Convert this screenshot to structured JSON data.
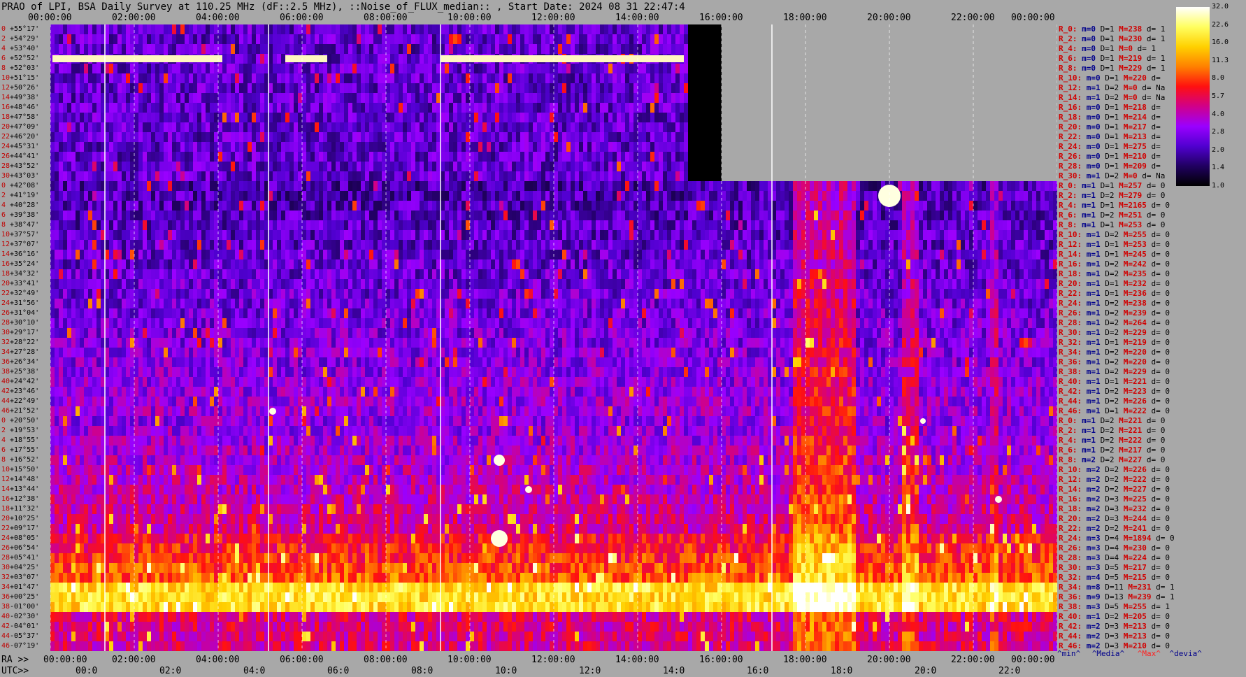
{
  "title": "PRAO of LPI, BSA Daily Survey at 110.25 MHz (dF::2.5 MHz), ::Noise_of_FLUX_median:: , Start Date: 2024 08 31 22:47:4",
  "top_times": [
    "00:00:00",
    "02:00:00",
    "04:00:00",
    "06:00:00",
    "08:00:00",
    "10:00:00",
    "12:00:00",
    "14:00:00",
    "16:00:00",
    "18:00:00",
    "20:00:00",
    "22:00:00",
    "00:00:00"
  ],
  "ra_label": "RA >>",
  "ra_times": [
    "00:00:00",
    "02:00:00",
    "04:00:00",
    "06:00:00",
    "08:00:00",
    "10:00:00",
    "12:00:00",
    "14:00:00",
    "16:00:00",
    "18:00:00",
    "20:00:00",
    "22:00:00",
    "00:00:00"
  ],
  "utc_label": "UTC>>",
  "utc_times": [
    "00:0",
    "02:0",
    "04:0",
    "06:0",
    "08:0",
    "10:0",
    "12:0",
    "14:0",
    "16:0",
    "18:0",
    "20:0",
    "22:0"
  ],
  "colorbar": {
    "ticks": [
      "32.0",
      "22.6",
      "16.0",
      "11.3",
      "8.0",
      "5.7",
      "4.0",
      "2.8",
      "2.0",
      "1.4",
      "1.0"
    ],
    "stops": [
      "#ffffff",
      "#ffff60",
      "#ffd000",
      "#ff8000",
      "#ff1010",
      "#d0008a",
      "#9a00ff",
      "#5000d0",
      "#200060",
      "#000000"
    ]
  },
  "legend_bottom": {
    "min": "^min^",
    "median": "^Media^",
    "max": "^Max^",
    "dev": "^devia^"
  },
  "chart_data": {
    "type": "heatmap",
    "title": "PRAO of LPI, BSA Daily Survey at 110.25 MHz (dF::2.5 MHz), ::Noise_of_FLUX_median:: , Start Date: 2024 08 31 22:47:4",
    "xlabel": "RA / UTC",
    "ylabel": "",
    "colorscale_range": [
      1.0,
      32.0
    ],
    "declinations": [
      "+55°17'",
      "+54°29'",
      "+53°40'",
      "+52°52'",
      "+52°03'",
      "+51°15'",
      "+50°26'",
      "+49°38'",
      "+48°46'",
      "+47°58'",
      "+47°09'",
      "+46°20'",
      "+45°31'",
      "+44°41'",
      "+43°52'",
      "+43°03'",
      "+42°08'",
      "+41°19'",
      "+40°28'",
      "+39°38'",
      "+38°47'",
      "+37°57'",
      "+37°07'",
      "+36°16'",
      "+35°24'",
      "+34°32'",
      "+33°41'",
      "+32°49'",
      "+31°56'",
      "+31°04'",
      "+30°10'",
      "+29°17'",
      "+28°22'",
      "+27°28'",
      "+26°34'",
      "+25°38'",
      "+24°42'",
      "+23°46'",
      "+22°49'",
      "+21°52'",
      "+20°50'",
      "+19°53'",
      "+18°55'",
      "+17°55'",
      "+16°52'",
      "+15°50'",
      "+14°48'",
      "+13°44'",
      "+12°38'",
      "+11°32'",
      "+10°25'",
      "+09°17'",
      "+08°05'",
      "+06°54'",
      "+05°41'",
      "+04°25'",
      "+03°07'",
      "+01°47'",
      "+00°25'",
      "-01°00'",
      "-02°30'",
      "-04°01'",
      "-05°37'",
      "-07°19'"
    ],
    "decl_index": [
      "0",
      "2",
      "4",
      "6",
      "8",
      "10",
      "12",
      "14",
      "16",
      "18",
      "20",
      "22",
      "24",
      "26",
      "28",
      "30",
      "0",
      "2",
      "4",
      "6",
      "8",
      "10",
      "12",
      "14",
      "16",
      "18",
      "20",
      "22",
      "24",
      "26",
      "28",
      "30",
      "32",
      "34",
      "36",
      "38",
      "40",
      "42",
      "44",
      "46",
      "0",
      "2",
      "4",
      "6",
      "8",
      "10",
      "12",
      "14",
      "16",
      "18",
      "20",
      "22",
      "24",
      "26",
      "28",
      "30",
      "32",
      "34",
      "36",
      "38",
      "40",
      "42",
      "44",
      "46"
    ],
    "ra_hours": [
      0,
      2,
      4,
      6,
      8,
      10,
      12,
      14,
      16,
      18,
      20,
      22,
      24
    ]
  },
  "stats": [
    {
      "r": "R_0:",
      "m": "m=0",
      "d": "D=1",
      "mx": "M=238",
      "dv": "d= 1"
    },
    {
      "r": "R_2:",
      "m": "m=0",
      "d": "D=1",
      "mx": "M=230",
      "dv": "d= 1"
    },
    {
      "r": "R_4:",
      "m": "m=0",
      "d": "D=1",
      "mx": "M=0",
      "dv": "d= 1"
    },
    {
      "r": "R_6:",
      "m": "m=0",
      "d": "D=1",
      "mx": "M=219",
      "dv": "d= 1"
    },
    {
      "r": "R_8:",
      "m": "m=0",
      "d": "D=1",
      "mx": "M=229",
      "dv": "d= 1"
    },
    {
      "r": "R_10:",
      "m": "m=0",
      "d": "D=1",
      "mx": "M=220",
      "dv": "d="
    },
    {
      "r": "R_12:",
      "m": "m=1",
      "d": "D=2",
      "mx": "M=0",
      "dv": "d= Na"
    },
    {
      "r": "R_14:",
      "m": "m=1",
      "d": "D=2",
      "mx": "M=0",
      "dv": "d= Na"
    },
    {
      "r": "R_16:",
      "m": "m=0",
      "d": "D=1",
      "mx": "M=218",
      "dv": "d="
    },
    {
      "r": "R_18:",
      "m": "m=0",
      "d": "D=1",
      "mx": "M=214",
      "dv": "d="
    },
    {
      "r": "R_20:",
      "m": "m=0",
      "d": "D=1",
      "mx": "M=217",
      "dv": "d="
    },
    {
      "r": "R_22:",
      "m": "m=0",
      "d": "D=1",
      "mx": "M=213",
      "dv": "d="
    },
    {
      "r": "R_24:",
      "m": "m=0",
      "d": "D=1",
      "mx": "M=275",
      "dv": "d="
    },
    {
      "r": "R_26:",
      "m": "m=0",
      "d": "D=1",
      "mx": "M=210",
      "dv": "d="
    },
    {
      "r": "R_28:",
      "m": "m=0",
      "d": "D=1",
      "mx": "M=209",
      "dv": "d="
    },
    {
      "r": "R_30:",
      "m": "m=1",
      "d": "D=2",
      "mx": "M=0",
      "dv": "d= Na"
    },
    {
      "r": "R_0:",
      "m": "m=1",
      "d": "D=1",
      "mx": "M=257",
      "dv": "d= 0"
    },
    {
      "r": "R_2:",
      "m": "m=1",
      "d": "D=2",
      "mx": "M=279",
      "dv": "d= 0"
    },
    {
      "r": "R_4:",
      "m": "m=1",
      "d": "D=1",
      "mx": "M=2165",
      "dv": "d= 0"
    },
    {
      "r": "R_6:",
      "m": "m=1",
      "d": "D=2",
      "mx": "M=251",
      "dv": "d= 0"
    },
    {
      "r": "R_8:",
      "m": "m=1",
      "d": "D=1",
      "mx": "M=253",
      "dv": "d= 0"
    },
    {
      "r": "R_10:",
      "m": "m=1",
      "d": "D=2",
      "mx": "M=255",
      "dv": "d= 0"
    },
    {
      "r": "R_12:",
      "m": "m=1",
      "d": "D=1",
      "mx": "M=253",
      "dv": "d= 0"
    },
    {
      "r": "R_14:",
      "m": "m=1",
      "d": "D=1",
      "mx": "M=245",
      "dv": "d= 0"
    },
    {
      "r": "R_16:",
      "m": "m=1",
      "d": "D=2",
      "mx": "M=242",
      "dv": "d= 0"
    },
    {
      "r": "R_18:",
      "m": "m=1",
      "d": "D=2",
      "mx": "M=235",
      "dv": "d= 0"
    },
    {
      "r": "R_20:",
      "m": "m=1",
      "d": "D=1",
      "mx": "M=232",
      "dv": "d= 0"
    },
    {
      "r": "R_22:",
      "m": "m=1",
      "d": "D=1",
      "mx": "M=236",
      "dv": "d= 0"
    },
    {
      "r": "R_24:",
      "m": "m=1",
      "d": "D=2",
      "mx": "M=238",
      "dv": "d= 0"
    },
    {
      "r": "R_26:",
      "m": "m=1",
      "d": "D=2",
      "mx": "M=239",
      "dv": "d= 0"
    },
    {
      "r": "R_28:",
      "m": "m=1",
      "d": "D=2",
      "mx": "M=264",
      "dv": "d= 0"
    },
    {
      "r": "R_30:",
      "m": "m=1",
      "d": "D=2",
      "mx": "M=229",
      "dv": "d= 0"
    },
    {
      "r": "R_32:",
      "m": "m=1",
      "d": "D=1",
      "mx": "M=219",
      "dv": "d= 0"
    },
    {
      "r": "R_34:",
      "m": "m=1",
      "d": "D=2",
      "mx": "M=220",
      "dv": "d= 0"
    },
    {
      "r": "R_36:",
      "m": "m=1",
      "d": "D=2",
      "mx": "M=220",
      "dv": "d= 0"
    },
    {
      "r": "R_38:",
      "m": "m=1",
      "d": "D=2",
      "mx": "M=229",
      "dv": "d= 0"
    },
    {
      "r": "R_40:",
      "m": "m=1",
      "d": "D=1",
      "mx": "M=221",
      "dv": "d= 0"
    },
    {
      "r": "R_42:",
      "m": "m=1",
      "d": "D=2",
      "mx": "M=223",
      "dv": "d= 0"
    },
    {
      "r": "R_44:",
      "m": "m=1",
      "d": "D=2",
      "mx": "M=226",
      "dv": "d= 0"
    },
    {
      "r": "R_46:",
      "m": "m=1",
      "d": "D=1",
      "mx": "M=222",
      "dv": "d= 0"
    },
    {
      "r": "R_0:",
      "m": "m=1",
      "d": "D=2",
      "mx": "M=221",
      "dv": "d= 0"
    },
    {
      "r": "R_2:",
      "m": "m=1",
      "d": "D=2",
      "mx": "M=221",
      "dv": "d= 0"
    },
    {
      "r": "R_4:",
      "m": "m=1",
      "d": "D=2",
      "mx": "M=222",
      "dv": "d= 0"
    },
    {
      "r": "R_6:",
      "m": "m=1",
      "d": "D=2",
      "mx": "M=217",
      "dv": "d= 0"
    },
    {
      "r": "R_8:",
      "m": "m=2",
      "d": "D=2",
      "mx": "M=227",
      "dv": "d= 0"
    },
    {
      "r": "R_10:",
      "m": "m=2",
      "d": "D=2",
      "mx": "M=226",
      "dv": "d= 0"
    },
    {
      "r": "R_12:",
      "m": "m=2",
      "d": "D=2",
      "mx": "M=222",
      "dv": "d= 0"
    },
    {
      "r": "R_14:",
      "m": "m=2",
      "d": "D=2",
      "mx": "M=227",
      "dv": "d= 0"
    },
    {
      "r": "R_16:",
      "m": "m=2",
      "d": "D=3",
      "mx": "M=225",
      "dv": "d= 0"
    },
    {
      "r": "R_18:",
      "m": "m=2",
      "d": "D=3",
      "mx": "M=232",
      "dv": "d= 0"
    },
    {
      "r": "R_20:",
      "m": "m=2",
      "d": "D=3",
      "mx": "M=244",
      "dv": "d= 0"
    },
    {
      "r": "R_22:",
      "m": "m=2",
      "d": "D=2",
      "mx": "M=241",
      "dv": "d= 0"
    },
    {
      "r": "R_24:",
      "m": "m=3",
      "d": "D=4",
      "mx": "M=1894",
      "dv": "d= 0"
    },
    {
      "r": "R_26:",
      "m": "m=3",
      "d": "D=4",
      "mx": "M=230",
      "dv": "d= 0"
    },
    {
      "r": "R_28:",
      "m": "m=3",
      "d": "D=4",
      "mx": "M=224",
      "dv": "d= 0"
    },
    {
      "r": "R_30:",
      "m": "m=3",
      "d": "D=5",
      "mx": "M=217",
      "dv": "d= 0"
    },
    {
      "r": "R_32:",
      "m": "m=4",
      "d": "D=5",
      "mx": "M=215",
      "dv": "d= 0"
    },
    {
      "r": "R_34:",
      "m": "m=8",
      "d": "D=11",
      "mx": "M=231",
      "dv": "d= 1"
    },
    {
      "r": "R_36:",
      "m": "m=9",
      "d": "D=13",
      "mx": "M=239",
      "dv": "d= 1"
    },
    {
      "r": "R_38:",
      "m": "m=3",
      "d": "D=5",
      "mx": "M=255",
      "dv": "d= 1"
    },
    {
      "r": "R_40:",
      "m": "m=1",
      "d": "D=2",
      "mx": "M=205",
      "dv": "d= 0"
    },
    {
      "r": "R_42:",
      "m": "m=2",
      "d": "D=3",
      "mx": "M=213",
      "dv": "d= 0"
    },
    {
      "r": "R_44:",
      "m": "m=2",
      "d": "D=3",
      "mx": "M=213",
      "dv": "d= 0"
    },
    {
      "r": "R_46:",
      "m": "m=2",
      "d": "D=3",
      "mx": "M=210",
      "dv": "d= 0"
    }
  ]
}
